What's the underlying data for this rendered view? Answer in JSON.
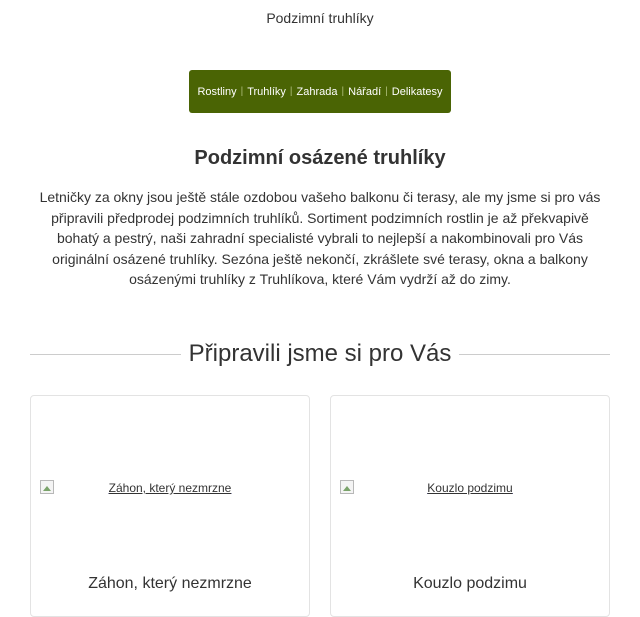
{
  "preheader": "Podzimní truhlíky",
  "nav": {
    "items": [
      {
        "label": "Rostliny"
      },
      {
        "label": "Truhlíky"
      },
      {
        "label": "Zahrada"
      },
      {
        "label": "Nářadí"
      },
      {
        "label": "Delikatesy"
      }
    ],
    "separator": "|",
    "background_color": "#4a6404"
  },
  "headline": "Podzimní osázené truhlíky",
  "intro": "Letničky za okny jsou ještě stále ozdobou vašeho balkonu či terasy, ale my jsme si pro vás připravili předprodej podzimních truhlíků. Sortiment podzimních rostlin je až překvapivě bohatý a pestrý, naši zahradní specialisté vybrali to nejlepší a nakombinovali pro Vás originální osázené truhlíky. Sezóna ještě nekončí, zkrášlete své terasy, okna a balkony osázenými truhlíky z Truhlíkova, které Vám vydrží až do zimy.",
  "section_title": "Připravili jsme si pro Vás",
  "products": [
    {
      "image_alt": "Záhon, který nezmrzne",
      "title": "Záhon, který nezmrzne",
      "image_icon": "broken-image-icon"
    },
    {
      "image_alt": "Kouzlo podzimu",
      "title": "Kouzlo podzimu",
      "image_icon": "broken-image-icon"
    }
  ]
}
